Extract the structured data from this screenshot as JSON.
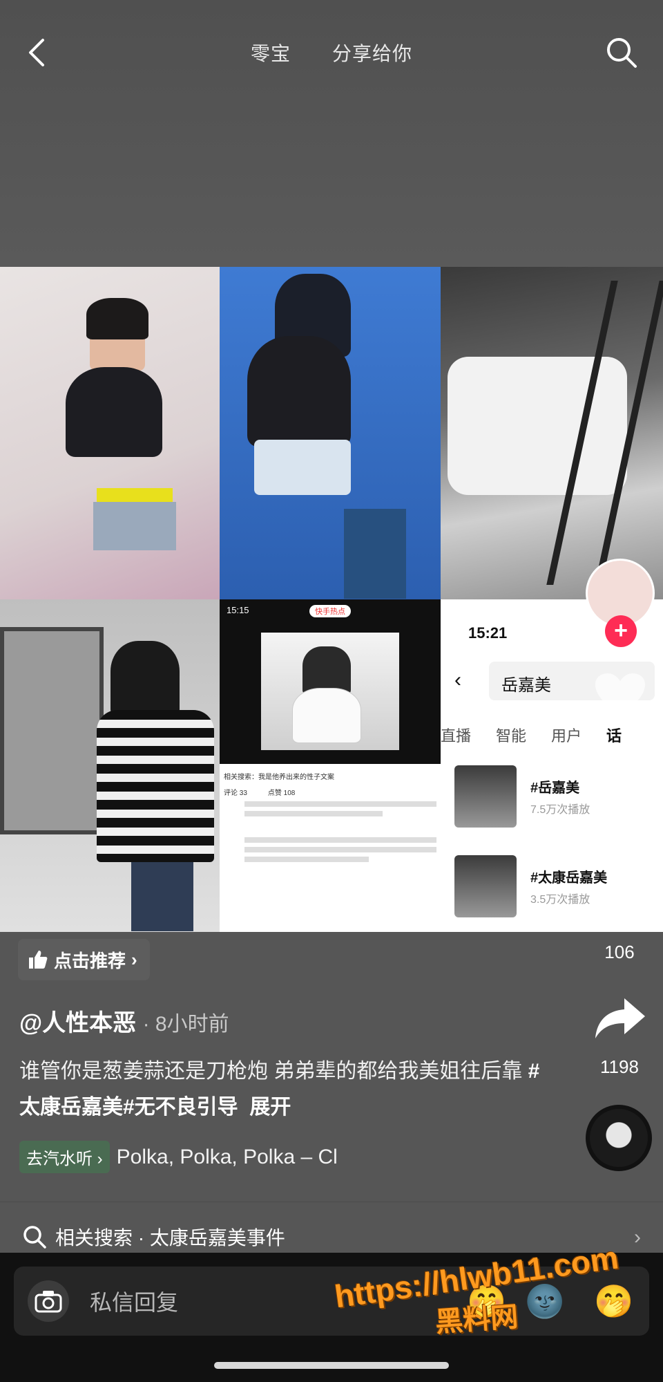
{
  "header": {
    "title_left": "零宝",
    "title_right": "分享给你"
  },
  "grid_tiles": {
    "tile5": {
      "time": "15:15",
      "pill": "快手热点",
      "comment_header": "相关搜索：我是他养出来的性子文案",
      "comments_label": "评论 33",
      "likes_label": "点赞 108"
    },
    "tile6": {
      "time": "15:21",
      "query": "岳嘉美",
      "tabs": [
        "直播",
        "智能",
        "用户",
        "话"
      ],
      "results": [
        {
          "title": "#岳嘉美",
          "sub": "7.5万次播放"
        },
        {
          "title": "#太康岳嘉美",
          "sub": "3.5万次播放"
        }
      ]
    }
  },
  "actions": {
    "like_count": "",
    "comment_count": "",
    "favorite_count": "106",
    "share_count": "1198"
  },
  "post": {
    "recommend_label": "点击推荐",
    "author": "@人性本恶",
    "time": "· 8小时前",
    "desc_text": "谁管你是葱姜蒜还是刀枪炮 弟弟辈的都给我美姐往后靠 ",
    "hashtags": "#太康岳嘉美#无不良引导",
    "expand": "展开",
    "music_chip": "去汽水听 ›",
    "music_name": "Polka, Polka, Polka – Cl"
  },
  "related": {
    "label": "相关搜索 · 太康岳嘉美事件"
  },
  "bottom": {
    "placeholder": "私信回复",
    "emojis": [
      "🤭",
      "🌚",
      "🤭"
    ]
  },
  "watermark": {
    "url": "https://hlwb11.com",
    "name": "黑料网"
  },
  "colors": {
    "accent": "#fe2c55",
    "background": "#565656",
    "music_chip": "#4a6b52"
  }
}
